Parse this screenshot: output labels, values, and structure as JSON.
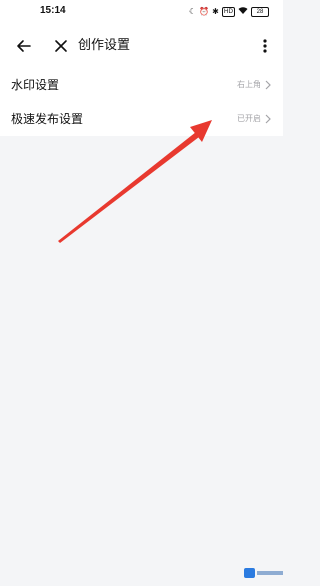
{
  "status_bar": {
    "time": "15:14",
    "icons": [
      "moon-icon",
      "alarm-icon",
      "bluetooth-icon",
      "hd-icon",
      "wifi-icon",
      "battery-icon"
    ],
    "hd_label": "HD",
    "battery_level": "28"
  },
  "header": {
    "title": "创作设置",
    "back_icon": "back-arrow-icon",
    "close_icon": "close-icon",
    "more_icon": "more-vertical-icon"
  },
  "settings": {
    "items": [
      {
        "label": "水印设置",
        "value": "右上角"
      },
      {
        "label": "极速发布设置",
        "value": "已开启"
      }
    ]
  },
  "annotation": {
    "color": "#e8392f",
    "icon": "red-pointer-arrow"
  },
  "watermark": {
    "logo_color": "#2b7be0"
  },
  "colors": {
    "background": "#f4f5f7",
    "surface": "#ffffff",
    "secondary_text": "#a4a4a8"
  }
}
